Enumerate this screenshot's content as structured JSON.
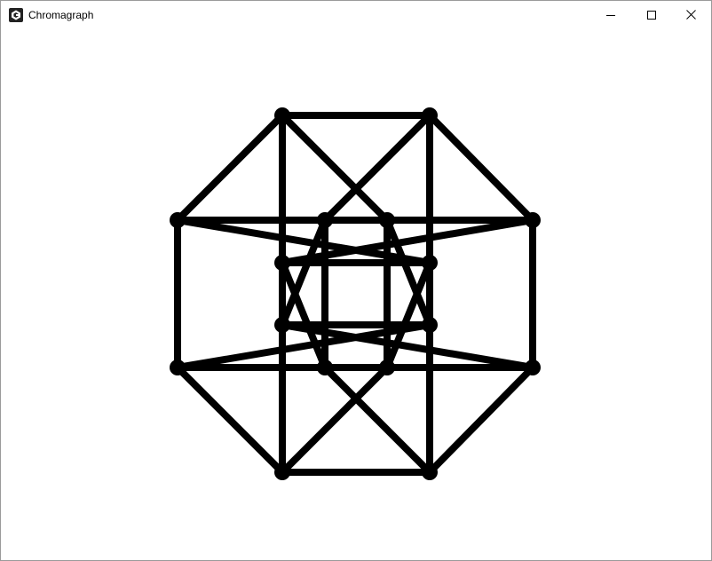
{
  "window": {
    "title": "Chromagraph",
    "app_icon": "chromagraph-app-icon",
    "controls": [
      {
        "name": "minimize",
        "icon": "minimize-icon"
      },
      {
        "name": "maximize",
        "icon": "maximize-icon"
      },
      {
        "name": "close",
        "icon": "close-icon"
      }
    ]
  },
  "graph": {
    "vertex_color": "#000000",
    "edge_color": "#000000",
    "background": "#ffffff",
    "vertex_count": 16,
    "edge_count": 32
  }
}
